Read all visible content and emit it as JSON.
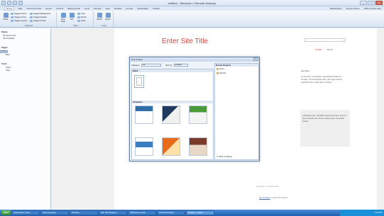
{
  "window": {
    "title": "untitled - Windows > Remote Desktop",
    "buttons": [
      "_",
      "□",
      "×"
    ]
  },
  "tabs": {
    "items": [
      "Home",
      "Edit",
      "Insert & Format",
      "Layout",
      "Content",
      "Backgrounds",
      "Tools",
      "Preview",
      "Help",
      "Window",
      "Format",
      "Visual Basic",
      "Publish"
    ],
    "right_links": [
      "Marketplace",
      "Support Home",
      "Office Online Help"
    ]
  },
  "ribbon": {
    "groups": [
      "Clipboard",
      "Page",
      "Insert"
    ],
    "items": [
      "Paste",
      "Suggest Colors",
      "Suggest Background",
      "Suggest Fonts",
      "Suggest Header",
      "Suggest Layout",
      "Suggest Footer",
      "New Page",
      "Text",
      "Links",
      "Picture",
      "Video",
      "Switch",
      "Export"
    ]
  },
  "left_panel": {
    "sections": [
      {
        "title": "Styles",
        "items": [
          "My Documents",
          "All Templates"
        ]
      },
      {
        "title": "Pages",
        "items": [
          "Home",
          "Blog"
        ]
      },
      {
        "title": "Tools",
        "items": [
          "Filters",
          "Tags"
        ]
      }
    ]
  },
  "site": {
    "title": "Enter Site Title",
    "search_icon": "search-icon",
    "nav": [
      "HOME",
      "BLOG"
    ],
    "welcome": "ped here.",
    "lorem": "on sit amet, consectetur sed pharetra tellus at semper, mis erat iaculis odio, ante eget mauris imperdiet arcu, vitae arem ut tellus.",
    "box_text": "sollicitudin sed. Curabitur parturiente felis, at amet ipsum iaculis sed. Donec risque justo venenatis frecisa.",
    "copyright": "Copyright © your site name",
    "footer_pre": "Site Template",
    "footer_post": " created with Artisteer"
  },
  "dialog": {
    "title": "New Project",
    "close": "×",
    "category_label": "Category:",
    "category_value": "All",
    "sort_label": "Sort by:",
    "sort_value": "Popular",
    "blank_header": "Blank",
    "templates_header": "Templates",
    "recent_header": "Recent Projects",
    "recent_items": [
      "Open...",
      "Sample"
    ],
    "more_link": "More on Startup"
  },
  "taskbar": {
    "start": "Start",
    "buttons": [
      "Collaboration Center",
      "Chat Computing",
      "Publisher",
      "Web Site Designers",
      "Publishing Console",
      "Site Administration",
      "Artisteer - Untitled"
    ],
    "tray_time": "4:32 PM"
  },
  "colors": {
    "site_accent": "#d6453d",
    "taskbar": "#1d5fb0"
  }
}
